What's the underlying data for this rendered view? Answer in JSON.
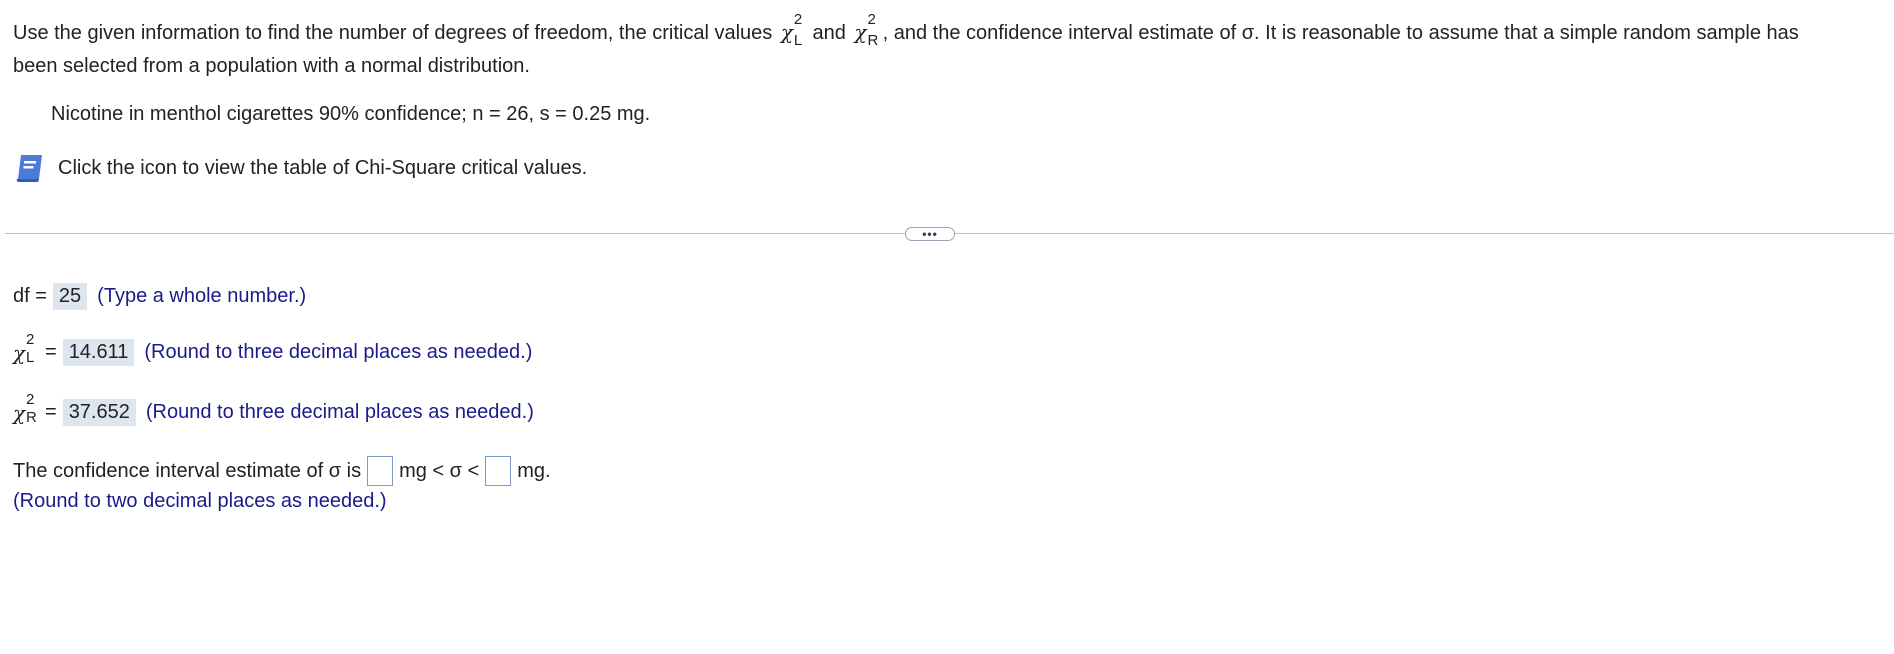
{
  "intro": {
    "part1": "Use the given information to find the number of degrees of freedom, the critical values",
    "chi_symbol": "χ",
    "sup": "2",
    "sub_left": "L",
    "sub_right": "R",
    "and": "and",
    "part2": ", and the confidence interval estimate of σ. It is reasonable to assume that a simple random sample has",
    "line2": "been selected from a population with a normal distribution."
  },
  "given": "Nicotine in menthol cigarettes 90% confidence; n = 26, s = 0.25 mg.",
  "table_link": {
    "icon": "book-icon",
    "label": "Click the icon to view the table of Chi-Square critical values."
  },
  "more_button": {
    "label": "•••"
  },
  "df": {
    "label": "df =",
    "value": "25",
    "hint": "(Type a whole number.)"
  },
  "chi_left": {
    "equals": "=",
    "value": "14.611",
    "hint": "(Round to three decimal places as needed.)"
  },
  "chi_right": {
    "equals": "=",
    "value": "37.652",
    "hint": "(Round to three decimal places as needed.)"
  },
  "ci": {
    "prefix": "The confidence interval estimate of σ is",
    "middle": "mg < σ <",
    "suffix": "mg.",
    "lower_value": "",
    "upper_value": "",
    "hint": "(Round to two decimal places as needed.)"
  },
  "colors": {
    "hint_blue": "#1a1a8c",
    "answer_bg": "#dde6ef",
    "icon_blue": "#4a7bd8"
  }
}
